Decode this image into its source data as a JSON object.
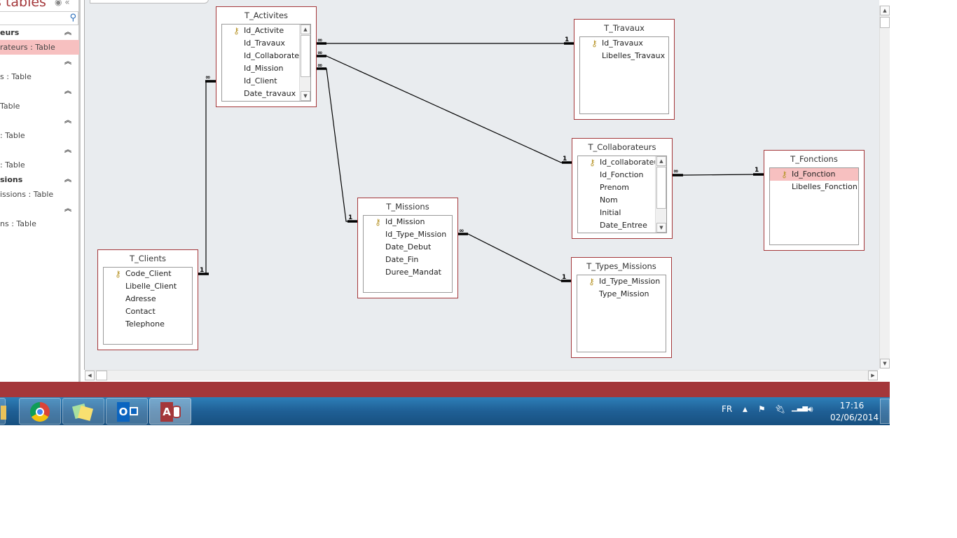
{
  "sidebar": {
    "title": "s tables",
    "search_icon": "search-icon",
    "rows": [
      {
        "type": "group",
        "label": "eurs"
      },
      {
        "type": "item",
        "label": "rateurs : Table",
        "selected": true
      },
      {
        "type": "group",
        "label": ""
      },
      {
        "type": "item",
        "label": "s : Table"
      },
      {
        "type": "group",
        "label": ""
      },
      {
        "type": "item",
        "label": "Table"
      },
      {
        "type": "group",
        "label": ""
      },
      {
        "type": "item",
        "label": ": Table"
      },
      {
        "type": "group",
        "label": ""
      },
      {
        "type": "item",
        "label": ": Table"
      },
      {
        "type": "group",
        "label": "sions"
      },
      {
        "type": "item",
        "label": "issions : Table"
      },
      {
        "type": "group",
        "label": ""
      },
      {
        "type": "item",
        "label": "ns : Table"
      }
    ]
  },
  "tables": {
    "activites": {
      "title": "T_Activites",
      "fields": [
        "Id_Activite",
        "Id_Travaux",
        "Id_Collaborateu",
        "Id_Mission",
        "Id_Client",
        "Date_travaux"
      ]
    },
    "travaux": {
      "title": "T_Travaux",
      "fields": [
        "Id_Travaux",
        "Libelles_Travaux"
      ]
    },
    "collaborateurs": {
      "title": "T_Collaborateurs",
      "fields": [
        "Id_collaborateu",
        "Id_Fonction",
        "Prenom",
        "Nom",
        "Initial",
        "Date_Entree"
      ]
    },
    "fonctions": {
      "title": "T_Fonctions",
      "fields": [
        "Id_Fonction",
        "Libelles_Fonction"
      ]
    },
    "missions": {
      "title": "T_Missions",
      "fields": [
        "Id_Mission",
        "Id_Type_Mission",
        "Date_Debut",
        "Date_Fin",
        "Duree_Mandat"
      ]
    },
    "types_missions": {
      "title": "T_Types_Missions",
      "fields": [
        "Id_Type_Mission",
        "Type_Mission"
      ]
    },
    "clients": {
      "title": "T_Clients",
      "fields": [
        "Code_Client",
        "Libelle_Client",
        "Adresse",
        "Contact",
        "Telephone"
      ]
    }
  },
  "relationships": {
    "one": "1",
    "many": "∞"
  },
  "taskbar": {
    "apps": [
      "chrome-icon",
      "sticky-notes-icon",
      "outlook-icon",
      "access-icon"
    ],
    "lang": "FR",
    "time": "17:16",
    "date": "02/06/2014"
  },
  "colors": {
    "accent": "#a4373a",
    "selection": "#f7c0c0",
    "canvas": "#e9ecef"
  }
}
